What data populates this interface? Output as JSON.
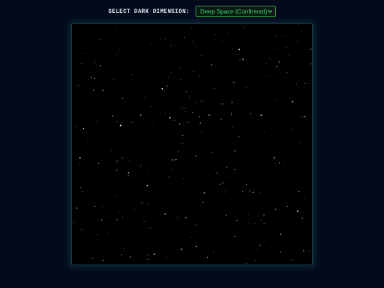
{
  "toolbar": {
    "label": "SELECT DARK DIMENSION:",
    "selected_dimension": "Deep Space (Confirmed)"
  },
  "colors": {
    "background": "#030a1b",
    "select_accent": "#2ea043",
    "select_text": "#3ddc67",
    "canvas_background": "#000000",
    "star": "#ffffff"
  },
  "icons": {
    "dropdown": "chevron-down-icon"
  }
}
